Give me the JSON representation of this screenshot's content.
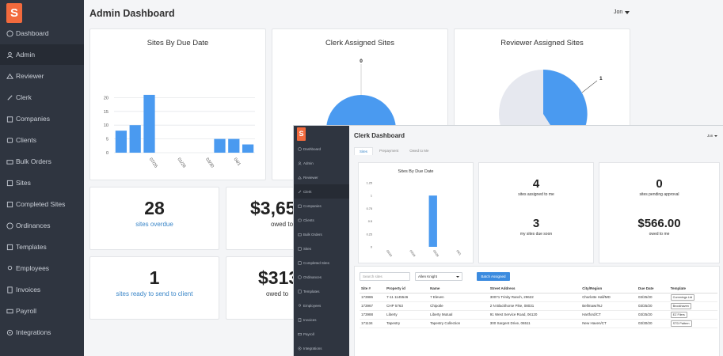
{
  "admin": {
    "logo_glyph": "S",
    "title": "Admin Dashboard",
    "user": "Jon",
    "nav": [
      {
        "label": "Dashboard",
        "icon": "dashboard-icon",
        "active": false
      },
      {
        "label": "Admin",
        "icon": "user-icon",
        "active": true
      },
      {
        "label": "Reviewer",
        "icon": "reviewer-icon",
        "active": false
      },
      {
        "label": "Clerk",
        "icon": "pencil-icon",
        "active": false
      },
      {
        "label": "Companies",
        "icon": "companies-icon",
        "active": false
      },
      {
        "label": "Clients",
        "icon": "clients-icon",
        "active": false
      },
      {
        "label": "Bulk Orders",
        "icon": "bulk-orders-icon",
        "active": false
      },
      {
        "label": "Sites",
        "icon": "sites-icon",
        "active": false
      },
      {
        "label": "Completed Sites",
        "icon": "completed-sites-icon",
        "active": false
      },
      {
        "label": "Ordinances",
        "icon": "ordinances-icon",
        "active": false
      },
      {
        "label": "Templates",
        "icon": "templates-icon",
        "active": false
      },
      {
        "label": "Employees",
        "icon": "employees-icon",
        "active": false
      },
      {
        "label": "Invoices",
        "icon": "invoices-icon",
        "active": false
      },
      {
        "label": "Payroll",
        "icon": "payroll-icon",
        "active": false
      },
      {
        "label": "Integrations",
        "icon": "integrations-icon",
        "active": false
      }
    ],
    "cards": {
      "sites_by_due_date_title": "Sites By Due Date",
      "clerk_assigned_title": "Clerk Assigned Sites",
      "reviewer_assigned_title": "Reviewer Assigned Sites",
      "sites_overdue_value": "28",
      "sites_overdue_label": "sites overdue",
      "owed_value": "$3,65",
      "owed_label": "owed to",
      "sites_ready_value": "1",
      "sites_ready_label": "sites ready to send to client",
      "owed2_value": "$313",
      "owed2_label": "owed to"
    },
    "colors": {
      "accent": "#4a9af0",
      "sidebar": "#2f3540",
      "logo": "#f26a3d",
      "link": "#3a86c8",
      "pie_bg": "#e6e8ef"
    }
  },
  "clerk": {
    "logo_glyph": "S",
    "title": "Clerk Dashboard",
    "user": "Jon",
    "tabs": [
      "Sites",
      "Prepayment",
      "Owed to Me"
    ],
    "nav": [
      {
        "label": "Dashboard",
        "icon": "dashboard-icon",
        "active": false
      },
      {
        "label": "Admin",
        "icon": "user-icon",
        "active": false
      },
      {
        "label": "Reviewer",
        "icon": "reviewer-icon",
        "active": false
      },
      {
        "label": "Clerk",
        "icon": "pencil-icon",
        "active": true
      },
      {
        "label": "Companies",
        "icon": "companies-icon",
        "active": false
      },
      {
        "label": "Clients",
        "icon": "clients-icon",
        "active": false
      },
      {
        "label": "Bulk Orders",
        "icon": "bulk-orders-icon",
        "active": false
      },
      {
        "label": "Sites",
        "icon": "sites-icon",
        "active": false
      },
      {
        "label": "Completed Sites",
        "icon": "completed-sites-icon",
        "active": false
      },
      {
        "label": "Ordinances",
        "icon": "ordinances-icon",
        "active": false
      },
      {
        "label": "Templates",
        "icon": "templates-icon",
        "active": false
      },
      {
        "label": "Employees",
        "icon": "employees-icon",
        "active": false
      },
      {
        "label": "Invoices",
        "icon": "invoices-icon",
        "active": false
      },
      {
        "label": "Payroll",
        "icon": "payroll-icon",
        "active": false
      },
      {
        "label": "Integrations",
        "icon": "integrations-icon",
        "active": false
      }
    ],
    "chart_title": "Sites By Due Date",
    "stats": {
      "assigned_value": "4",
      "assigned_label": "sites assigned to me",
      "pending_value": "0",
      "pending_label": "sites pending approval",
      "due_soon_value": "3",
      "due_soon_label": "my sites due soon",
      "owed_value": "$566.00",
      "owed_label": "owed to me"
    },
    "search_placeholder": "Search sites",
    "assignee_select": "Allen Knight",
    "assign_button": "Batch Assigned",
    "table": {
      "headers": [
        "Site #",
        "Property id",
        "Name",
        "Street Address",
        "City/Region",
        "Due Date",
        "Template"
      ],
      "rows": [
        [
          "173986",
          "7-11 1145546",
          "7 Eleven",
          "30071 Trinity Ranch, 29622",
          "Charlotte Hall/MD",
          "03/25/20",
          "Cummings Ltd"
        ],
        [
          "173967",
          "CHP 5763",
          "Chipotle",
          "2 N Blackhorse Pike, 08031",
          "Bellmawr/NJ",
          "03/25/20",
          "Brookhaven"
        ],
        [
          "173988",
          "Liberty",
          "Liberty Mutual",
          "91 West Service Road, 06120",
          "Hartford/CT",
          "03/25/20",
          "EZ Filers"
        ],
        [
          "171134",
          "Tapestry",
          "Tapestry Collection",
          "300 Sargent Drive, 06511",
          "New Haven/CT",
          "03/30/20",
          "STD Pattern"
        ]
      ]
    }
  },
  "chart_data": [
    {
      "type": "bar",
      "title": "Sites By Due Date",
      "categories": [
        "",
        "",
        "07/26",
        "",
        "",
        "01/28",
        "",
        "",
        "03/30",
        "",
        "04/1"
      ],
      "values": [
        8,
        10,
        21,
        0,
        0,
        0,
        0,
        5,
        5,
        3
      ],
      "ylim": [
        0,
        25
      ],
      "yticks": [
        0,
        5,
        10,
        15,
        20
      ],
      "x_tick_labels": [
        "07/26",
        "01/28",
        "03/30",
        "04/1"
      ],
      "grid": true
    },
    {
      "type": "pie",
      "title": "Clerk Assigned Sites",
      "labels": [
        "0"
      ],
      "values": [
        1
      ]
    },
    {
      "type": "pie",
      "title": "Reviewer Assigned Sites",
      "labels": [
        "1"
      ],
      "values": [
        0.3,
        0.7
      ]
    },
    {
      "type": "bar",
      "title": "Sites By Due Date",
      "categories": [
        "03/24",
        "03/26",
        "03/28",
        "04/1"
      ],
      "values": [
        0,
        0,
        1,
        0
      ],
      "ylim": [
        0,
        1.25
      ],
      "yticks": [
        0,
        0.25,
        0.5,
        0.75,
        1,
        1.25
      ],
      "grid": false
    }
  ]
}
